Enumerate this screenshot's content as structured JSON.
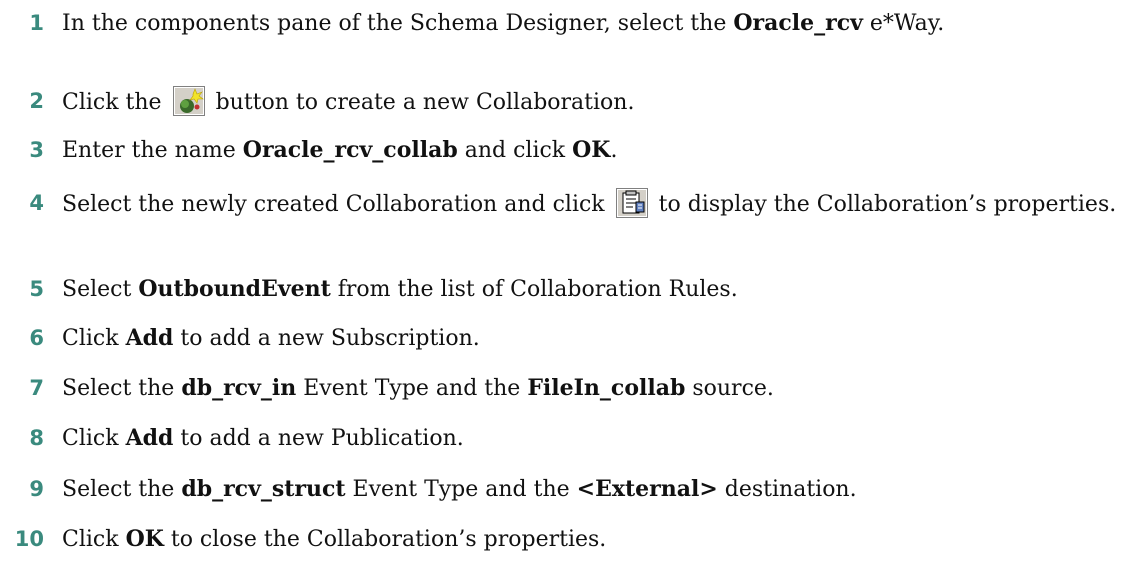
{
  "steps": [
    {
      "num": "1",
      "parts": [
        {
          "t": "In the components pane of the Schema Designer, select the "
        },
        {
          "b": "Oracle_rcv"
        },
        {
          "t": " e*Way."
        }
      ]
    },
    {
      "num": "2",
      "parts": [
        {
          "t": "Click the "
        },
        {
          "icon": "new-collaboration-icon"
        },
        {
          "t": " button to create a new Collaboration."
        }
      ]
    },
    {
      "num": "3",
      "parts": [
        {
          "t": "Enter the name "
        },
        {
          "b": "Oracle_rcv_collab"
        },
        {
          "t": " and click "
        },
        {
          "b": "OK"
        },
        {
          "t": "."
        }
      ]
    },
    {
      "num": "4",
      "parts": [
        {
          "t": "Select the newly created Collaboration and click "
        },
        {
          "icon": "properties-icon"
        },
        {
          "t": " to display the Collaboration’s properties."
        }
      ]
    },
    {
      "num": "5",
      "parts": [
        {
          "t": "Select "
        },
        {
          "b": "OutboundEvent"
        },
        {
          "t": " from the list of Collaboration Rules."
        }
      ]
    },
    {
      "num": "6",
      "parts": [
        {
          "t": "Click "
        },
        {
          "b": "Add"
        },
        {
          "t": " to add a new Subscription."
        }
      ]
    },
    {
      "num": "7",
      "parts": [
        {
          "t": "Select the "
        },
        {
          "b": "db_rcv_in"
        },
        {
          "t": " Event Type and the "
        },
        {
          "b": "FileIn_collab"
        },
        {
          "t": " source."
        }
      ]
    },
    {
      "num": "8",
      "parts": [
        {
          "t": "Click "
        },
        {
          "b": "Add"
        },
        {
          "t": " to add a new Publication."
        }
      ]
    },
    {
      "num": "9",
      "parts": [
        {
          "t": "Select the "
        },
        {
          "b": "db_rcv_struct"
        },
        {
          "t": " Event Type and the "
        },
        {
          "b": "<External>"
        },
        {
          "t": " destination."
        }
      ]
    },
    {
      "num": "10",
      "parts": [
        {
          "t": "Click "
        },
        {
          "b": "OK"
        },
        {
          "t": " to close the Collaboration’s properties."
        }
      ]
    }
  ],
  "colors": {
    "step_number": "#3a8a7e",
    "text": "#111111"
  }
}
